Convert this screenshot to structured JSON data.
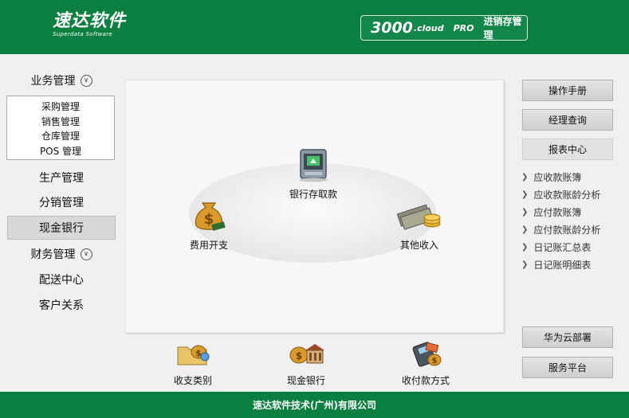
{
  "header": {
    "logo_cn": "速达软件",
    "logo_en": "Superdata Software",
    "brand_main": "3000",
    "brand_cloud": ".cloud",
    "brand_pro": "PRO",
    "brand_desc": "进销存管理"
  },
  "nav": {
    "business": "业务管理",
    "submenu": [
      "采购管理",
      "销售管理",
      "仓库管理",
      "POS 管理"
    ],
    "production": "生产管理",
    "distribution": "分销管理",
    "cash_bank": "现金银行",
    "finance": "财务管理",
    "delivery": "配送中心",
    "customer": "客户关系"
  },
  "diagram": {
    "bank": "银行存取款",
    "expense": "费用开支",
    "other_income": "其他收入"
  },
  "shortcuts": {
    "category": "收支类别",
    "cash_bank": "现金银行",
    "payment_method": "收付款方式"
  },
  "right": {
    "manual": "操作手册",
    "manager_query": "经理查询",
    "report_center": "报表中心",
    "links": [
      "应收款账簿",
      "应收款账龄分析",
      "应付款账簿",
      "应付款账龄分析",
      "日记账汇总表",
      "日记账明细表"
    ],
    "huawei": "华为云部署",
    "service": "服务平台"
  },
  "footer": {
    "company": "速达软件技术(广州)有限公司"
  },
  "colors": {
    "header_green": "#0b7f3f",
    "panel_bg": "#f7f7f7"
  },
  "icons": {
    "bank": "atm-icon",
    "expense": "money-bag-icon",
    "other_income": "cash-coins-icon",
    "category": "folder-money-icon",
    "cash_bank": "bank-building-icon",
    "payment_method": "card-reader-icon"
  }
}
